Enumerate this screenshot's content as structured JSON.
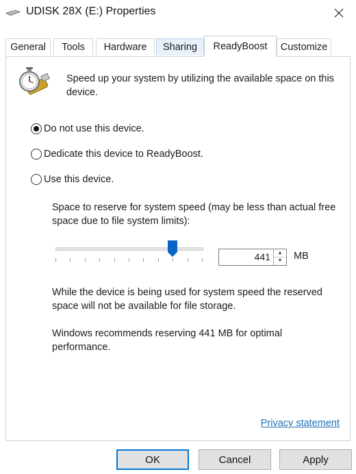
{
  "window": {
    "title": "UDISK 28X (E:) Properties"
  },
  "tabs": [
    {
      "label": "General"
    },
    {
      "label": "Tools"
    },
    {
      "label": "Hardware"
    },
    {
      "label": "Sharing"
    },
    {
      "label": "ReadyBoost"
    },
    {
      "label": "Customize"
    }
  ],
  "active_tab": "ReadyBoost",
  "readyboost": {
    "intro": "Speed up your system by utilizing the available space on this device.",
    "options": [
      {
        "label": "Do not use this device.",
        "selected": true
      },
      {
        "label": "Dedicate this device to ReadyBoost.",
        "selected": false
      },
      {
        "label": "Use this device.",
        "selected": false
      }
    ],
    "reserve_label": "Space to reserve for system speed (may be less than actual free space due to file system limits):",
    "slider_position": 0.8,
    "reserve_value": "441",
    "unit": "MB",
    "info_text": "While the device is being used for system speed the reserved space will not be available for file storage.",
    "recommend_text": "Windows recommends reserving 441 MB for optimal performance."
  },
  "privacy_link": "Privacy statement",
  "buttons": {
    "ok": "OK",
    "cancel": "Cancel",
    "apply": "Apply"
  },
  "colors": {
    "link": "#1f6fb5",
    "default_button_border": "#0078d7",
    "slider_thumb": "#0a64c8"
  }
}
